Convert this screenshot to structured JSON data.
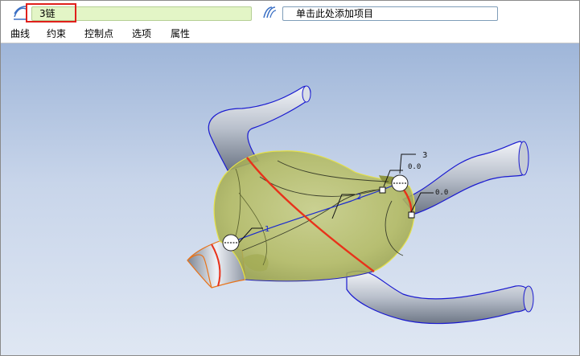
{
  "toolbar": {
    "chain_field_value": "3链",
    "item_field_text": "单击此处添加项目"
  },
  "menu": {
    "items": [
      "曲线",
      "约束",
      "控制点",
      "选项",
      "属性"
    ]
  },
  "viewport": {
    "labels": {
      "a": "1",
      "b": "2",
      "c": "3",
      "d": "0.0",
      "e": "0.0"
    }
  },
  "colors": {
    "highlight": "#e0201b",
    "chain_field": "#e3f5c6",
    "surface": "#b8be63",
    "edge": "#1a1ad0",
    "boundary_red": "#e8321a"
  }
}
